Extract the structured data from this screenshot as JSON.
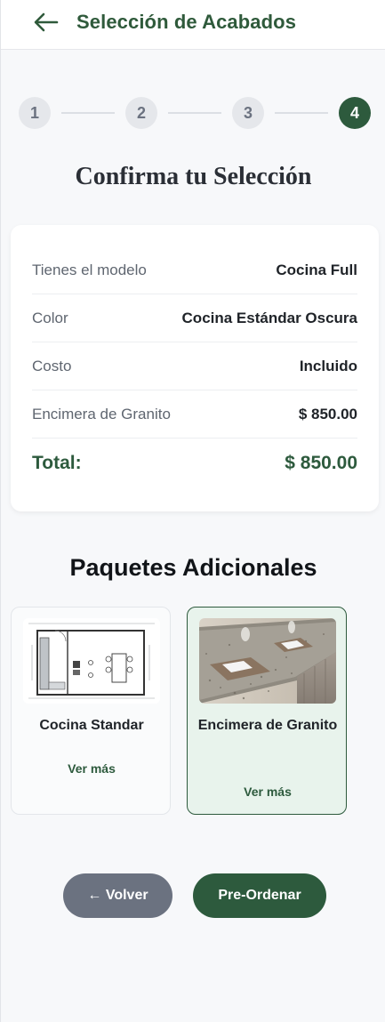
{
  "header": {
    "title": "Selección de Acabados",
    "back_icon": "arrow-left-icon"
  },
  "stepper": {
    "steps": [
      "1",
      "2",
      "3",
      "4"
    ],
    "active_step": 4
  },
  "confirm_title": "Confirma tu Selección",
  "summary": {
    "rows": [
      {
        "label": "Tienes el modelo",
        "value": "Cocina Full"
      },
      {
        "label": "Color",
        "value": "Cocina Estándar Oscura"
      },
      {
        "label": "Costo",
        "value": "Incluido"
      },
      {
        "label": "Encimera de Granito",
        "value": "$ 850.00"
      }
    ],
    "total_label": "Total:",
    "total_value": "$ 850.00"
  },
  "packages": {
    "title": "Paquetes Adicionales",
    "items": [
      {
        "name": "Cocina Standar",
        "more": "Ver más",
        "selected": false,
        "image": "kitchen-floorplan-image"
      },
      {
        "name": "Encimera de Granito",
        "more": "Ver más",
        "selected": true,
        "image": "granite-countertop-image"
      }
    ]
  },
  "actions": {
    "back_label": "← Volver",
    "order_label": "Pre-Ordenar"
  },
  "colors": {
    "brand_green": "#2d5a3d",
    "selected_bg": "#e8f3ec",
    "back_button": "#6b7280",
    "background": "#f7f8fa"
  }
}
